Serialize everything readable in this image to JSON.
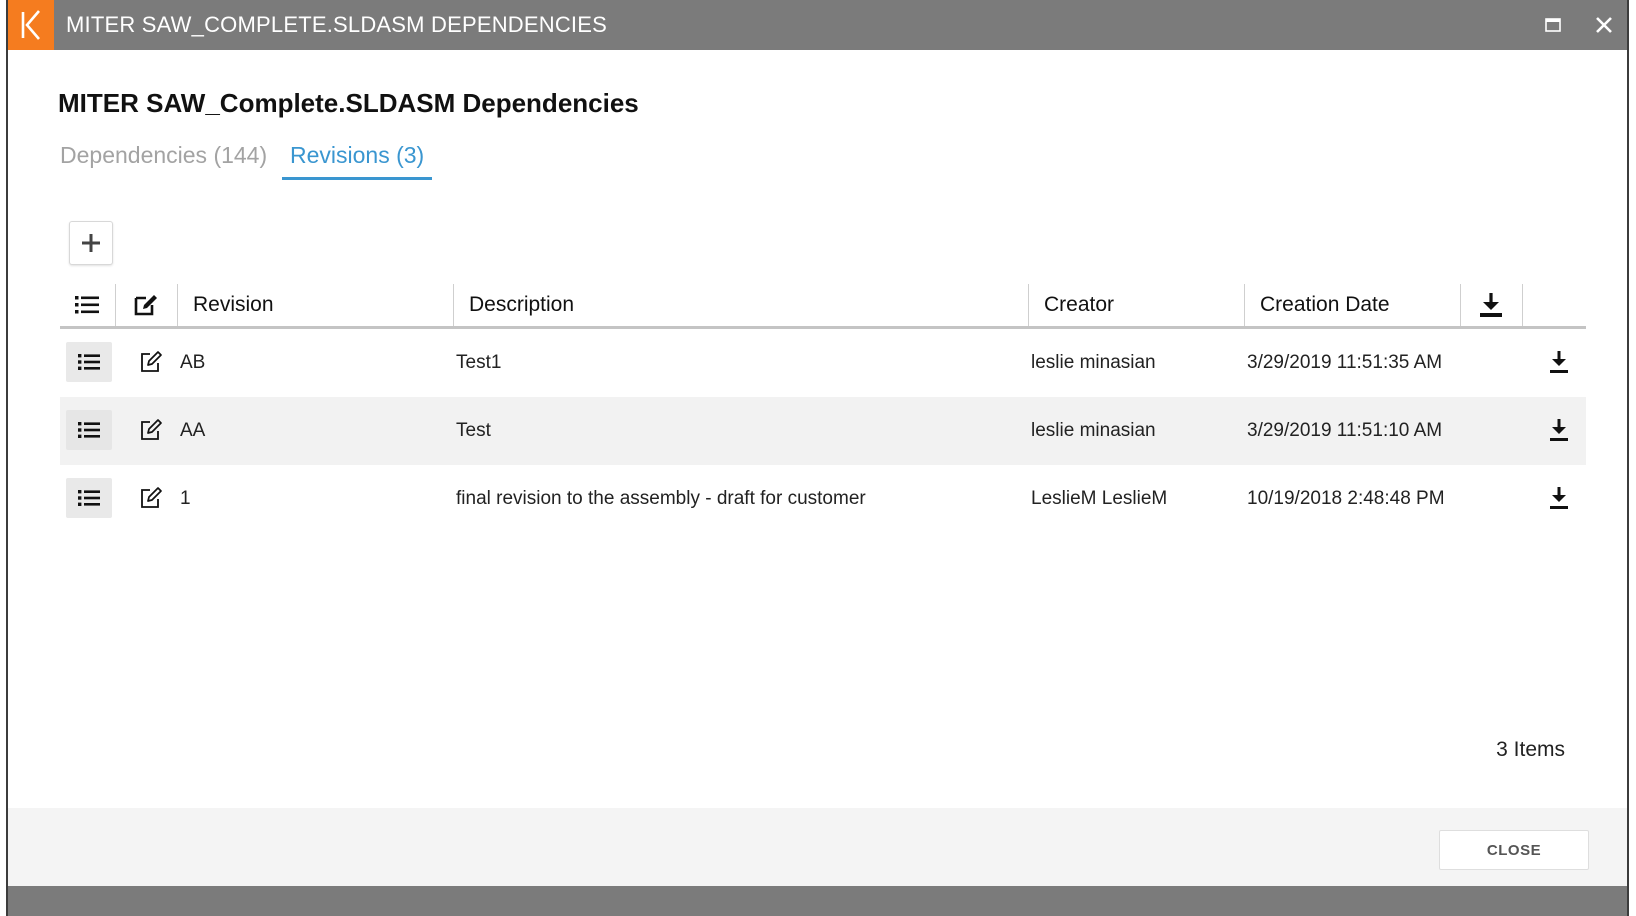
{
  "window": {
    "title": "MITER SAW_COMPLETE.SLDASM DEPENDENCIES",
    "logo_icon": "k-logo-icon",
    "maximize_icon": "maximize-icon",
    "close_icon": "close-icon"
  },
  "heading": "MITER SAW_Complete.SLDASM Dependencies",
  "tabs": [
    {
      "label": "Dependencies (144)",
      "active": false
    },
    {
      "label": "Revisions (3)",
      "active": true
    }
  ],
  "toolbar": {
    "add_icon": "plus-icon"
  },
  "table": {
    "header_icons": [
      "list-icon",
      "edit-icon",
      "download-icon"
    ],
    "columns": [
      "Revision",
      "Description",
      "Creator",
      "Creation Date"
    ],
    "rows": [
      {
        "revision": "AB",
        "description": "Test1",
        "creator": "leslie minasian",
        "date": "3/29/2019 11:51:35 AM"
      },
      {
        "revision": "AA",
        "description": "Test",
        "creator": "leslie minasian",
        "date": "3/29/2019 11:51:10 AM"
      },
      {
        "revision": "1",
        "description": "final revision to the assembly - draft for customer",
        "creator": "LeslieM LeslieM",
        "date": "10/19/2018 2:48:48 PM"
      }
    ]
  },
  "items_count": "3 Items",
  "footer": {
    "close_label": "CLOSE"
  },
  "colors": {
    "titlebar": "#7b7b7b",
    "logo": "#f57c1f",
    "accent_tab": "#3a96d0",
    "inactive_tab": "#a3a3a3",
    "alt_row": "#f2f2f2"
  }
}
